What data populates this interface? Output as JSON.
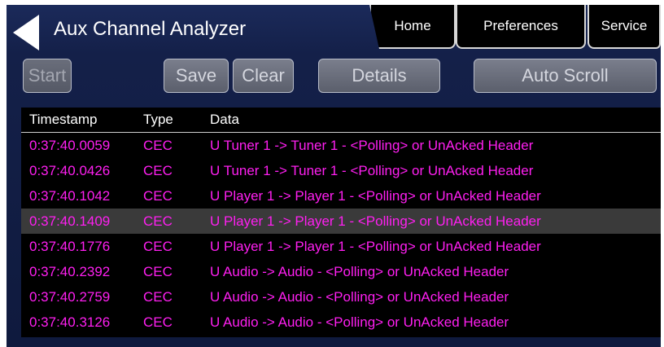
{
  "header": {
    "title": "Aux Channel Analyzer",
    "tabs": {
      "home": "Home",
      "preferences": "Preferences",
      "service": "Service"
    }
  },
  "toolbar": {
    "start": "Start",
    "save": "Save",
    "clear": "Clear",
    "details": "Details",
    "auto_scroll": "Auto Scroll"
  },
  "table": {
    "columns": [
      "Timestamp",
      "Type",
      "Data"
    ],
    "selected_row": 3,
    "rows": [
      [
        "0:37:40.0059",
        "CEC",
        "U Tuner 1 -> Tuner 1 - <Polling> or UnAcked Header"
      ],
      [
        "0:37:40.0426",
        "CEC",
        "U Tuner 1 -> Tuner 1 - <Polling> or UnAcked Header"
      ],
      [
        "0:37:40.1042",
        "CEC",
        "U Player 1 -> Player 1 - <Polling> or UnAcked Header"
      ],
      [
        "0:37:40.1409",
        "CEC",
        "U Player 1 -> Player 1 - <Polling> or UnAcked Header"
      ],
      [
        "0:37:40.1776",
        "CEC",
        "U Player 1 -> Player 1 - <Polling> or UnAcked Header"
      ],
      [
        "0:37:40.2392",
        "CEC",
        "U Audio -> Audio - <Polling> or UnAcked Header"
      ],
      [
        "0:37:40.2759",
        "CEC",
        "U Audio -> Audio - <Polling> or UnAcked Header"
      ],
      [
        "0:37:40.3126",
        "CEC",
        "U Audio -> Audio - <Polling> or UnAcked Header"
      ]
    ]
  },
  "colors": {
    "background": "#142049",
    "row_text": "#ff1ff1",
    "selected_row": "#3a3a3a"
  }
}
